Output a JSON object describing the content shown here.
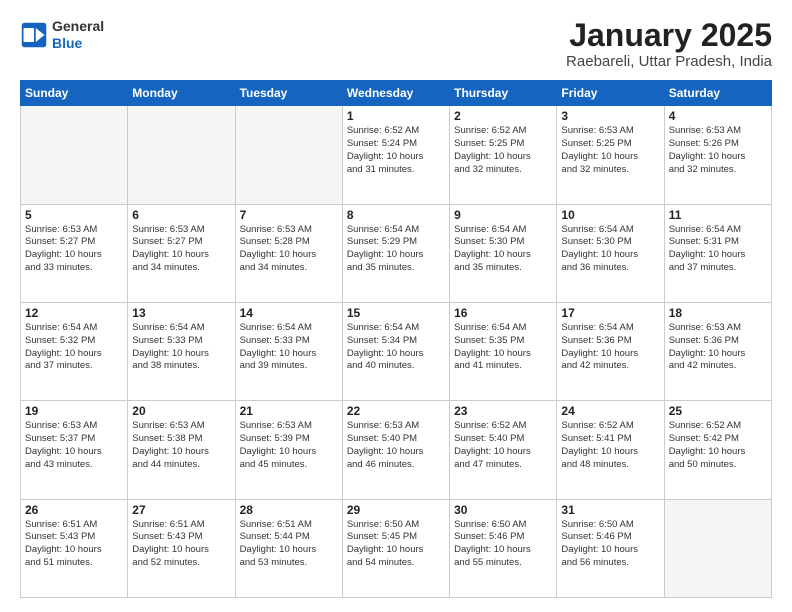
{
  "header": {
    "logo_general": "General",
    "logo_blue": "Blue",
    "title": "January 2025",
    "subtitle": "Raebareli, Uttar Pradesh, India"
  },
  "weekdays": [
    "Sunday",
    "Monday",
    "Tuesday",
    "Wednesday",
    "Thursday",
    "Friday",
    "Saturday"
  ],
  "weeks": [
    [
      {
        "day": "",
        "info": ""
      },
      {
        "day": "",
        "info": ""
      },
      {
        "day": "",
        "info": ""
      },
      {
        "day": "1",
        "info": "Sunrise: 6:52 AM\nSunset: 5:24 PM\nDaylight: 10 hours\nand 31 minutes."
      },
      {
        "day": "2",
        "info": "Sunrise: 6:52 AM\nSunset: 5:25 PM\nDaylight: 10 hours\nand 32 minutes."
      },
      {
        "day": "3",
        "info": "Sunrise: 6:53 AM\nSunset: 5:25 PM\nDaylight: 10 hours\nand 32 minutes."
      },
      {
        "day": "4",
        "info": "Sunrise: 6:53 AM\nSunset: 5:26 PM\nDaylight: 10 hours\nand 32 minutes."
      }
    ],
    [
      {
        "day": "5",
        "info": "Sunrise: 6:53 AM\nSunset: 5:27 PM\nDaylight: 10 hours\nand 33 minutes."
      },
      {
        "day": "6",
        "info": "Sunrise: 6:53 AM\nSunset: 5:27 PM\nDaylight: 10 hours\nand 34 minutes."
      },
      {
        "day": "7",
        "info": "Sunrise: 6:53 AM\nSunset: 5:28 PM\nDaylight: 10 hours\nand 34 minutes."
      },
      {
        "day": "8",
        "info": "Sunrise: 6:54 AM\nSunset: 5:29 PM\nDaylight: 10 hours\nand 35 minutes."
      },
      {
        "day": "9",
        "info": "Sunrise: 6:54 AM\nSunset: 5:30 PM\nDaylight: 10 hours\nand 35 minutes."
      },
      {
        "day": "10",
        "info": "Sunrise: 6:54 AM\nSunset: 5:30 PM\nDaylight: 10 hours\nand 36 minutes."
      },
      {
        "day": "11",
        "info": "Sunrise: 6:54 AM\nSunset: 5:31 PM\nDaylight: 10 hours\nand 37 minutes."
      }
    ],
    [
      {
        "day": "12",
        "info": "Sunrise: 6:54 AM\nSunset: 5:32 PM\nDaylight: 10 hours\nand 37 minutes."
      },
      {
        "day": "13",
        "info": "Sunrise: 6:54 AM\nSunset: 5:33 PM\nDaylight: 10 hours\nand 38 minutes."
      },
      {
        "day": "14",
        "info": "Sunrise: 6:54 AM\nSunset: 5:33 PM\nDaylight: 10 hours\nand 39 minutes."
      },
      {
        "day": "15",
        "info": "Sunrise: 6:54 AM\nSunset: 5:34 PM\nDaylight: 10 hours\nand 40 minutes."
      },
      {
        "day": "16",
        "info": "Sunrise: 6:54 AM\nSunset: 5:35 PM\nDaylight: 10 hours\nand 41 minutes."
      },
      {
        "day": "17",
        "info": "Sunrise: 6:54 AM\nSunset: 5:36 PM\nDaylight: 10 hours\nand 42 minutes."
      },
      {
        "day": "18",
        "info": "Sunrise: 6:53 AM\nSunset: 5:36 PM\nDaylight: 10 hours\nand 42 minutes."
      }
    ],
    [
      {
        "day": "19",
        "info": "Sunrise: 6:53 AM\nSunset: 5:37 PM\nDaylight: 10 hours\nand 43 minutes."
      },
      {
        "day": "20",
        "info": "Sunrise: 6:53 AM\nSunset: 5:38 PM\nDaylight: 10 hours\nand 44 minutes."
      },
      {
        "day": "21",
        "info": "Sunrise: 6:53 AM\nSunset: 5:39 PM\nDaylight: 10 hours\nand 45 minutes."
      },
      {
        "day": "22",
        "info": "Sunrise: 6:53 AM\nSunset: 5:40 PM\nDaylight: 10 hours\nand 46 minutes."
      },
      {
        "day": "23",
        "info": "Sunrise: 6:52 AM\nSunset: 5:40 PM\nDaylight: 10 hours\nand 47 minutes."
      },
      {
        "day": "24",
        "info": "Sunrise: 6:52 AM\nSunset: 5:41 PM\nDaylight: 10 hours\nand 48 minutes."
      },
      {
        "day": "25",
        "info": "Sunrise: 6:52 AM\nSunset: 5:42 PM\nDaylight: 10 hours\nand 50 minutes."
      }
    ],
    [
      {
        "day": "26",
        "info": "Sunrise: 6:51 AM\nSunset: 5:43 PM\nDaylight: 10 hours\nand 51 minutes."
      },
      {
        "day": "27",
        "info": "Sunrise: 6:51 AM\nSunset: 5:43 PM\nDaylight: 10 hours\nand 52 minutes."
      },
      {
        "day": "28",
        "info": "Sunrise: 6:51 AM\nSunset: 5:44 PM\nDaylight: 10 hours\nand 53 minutes."
      },
      {
        "day": "29",
        "info": "Sunrise: 6:50 AM\nSunset: 5:45 PM\nDaylight: 10 hours\nand 54 minutes."
      },
      {
        "day": "30",
        "info": "Sunrise: 6:50 AM\nSunset: 5:46 PM\nDaylight: 10 hours\nand 55 minutes."
      },
      {
        "day": "31",
        "info": "Sunrise: 6:50 AM\nSunset: 5:46 PM\nDaylight: 10 hours\nand 56 minutes."
      },
      {
        "day": "",
        "info": ""
      }
    ]
  ]
}
